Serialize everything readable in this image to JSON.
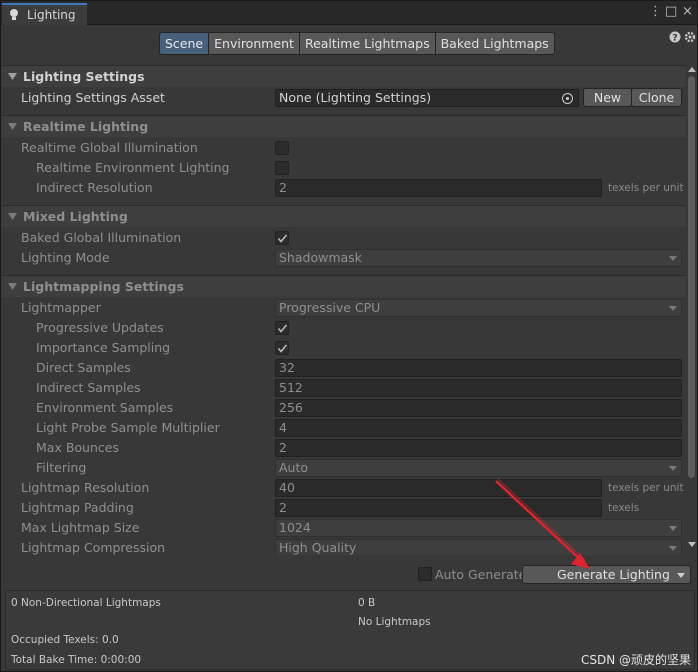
{
  "window": {
    "tab_title": "Lighting",
    "controls": [
      "⋮",
      "□",
      "×"
    ]
  },
  "mode_tabs": [
    {
      "label": "Scene",
      "active": true
    },
    {
      "label": "Environment",
      "active": false
    },
    {
      "label": "Realtime Lightmaps",
      "active": false
    },
    {
      "label": "Baked Lightmaps",
      "active": false
    }
  ],
  "lighting_settings": {
    "header": "Lighting Settings",
    "asset_label": "Lighting Settings Asset",
    "asset_value": "None (Lighting Settings)",
    "new_label": "New",
    "clone_label": "Clone"
  },
  "realtime": {
    "header": "Realtime Lighting",
    "gi_label": "Realtime Global Illumination",
    "gi_checked": false,
    "env_label": "Realtime Environment Lighting",
    "env_checked": false,
    "indirect_label": "Indirect Resolution",
    "indirect_value": "2",
    "indirect_unit": "texels per unit"
  },
  "mixed": {
    "header": "Mixed Lighting",
    "baked_gi_label": "Baked Global Illumination",
    "baked_gi_checked": true,
    "mode_label": "Lighting Mode",
    "mode_value": "Shadowmask"
  },
  "lightmapping": {
    "header": "Lightmapping Settings",
    "lightmapper_label": "Lightmapper",
    "lightmapper_value": "Progressive CPU",
    "progressive_label": "Progressive Updates",
    "progressive_checked": true,
    "importance_label": "Importance Sampling",
    "importance_checked": true,
    "direct_label": "Direct Samples",
    "direct_value": "32",
    "indirect_label": "Indirect Samples",
    "indirect_value": "512",
    "env_label": "Environment Samples",
    "env_value": "256",
    "probe_label": "Light Probe Sample Multiplier",
    "probe_value": "4",
    "bounces_label": "Max Bounces",
    "bounces_value": "2",
    "filtering_label": "Filtering",
    "filtering_value": "Auto",
    "resolution_label": "Lightmap Resolution",
    "resolution_value": "40",
    "resolution_unit": "texels per unit",
    "padding_label": "Lightmap Padding",
    "padding_value": "2",
    "padding_unit": "texels",
    "maxsize_label": "Max Lightmap Size",
    "maxsize_value": "1024",
    "compression_label": "Lightmap Compression",
    "compression_value": "High Quality"
  },
  "generate": {
    "auto_label": "Auto Generate",
    "auto_checked": false,
    "button_label": "Generate Lighting"
  },
  "stats": {
    "lightmaps": "0 Non-Directional Lightmaps",
    "size": "0 B",
    "no_lightmaps": "No Lightmaps",
    "occupied": "Occupied Texels: 0.0",
    "bake_time": "Total Bake Time: 0:00:00"
  },
  "watermark": "CSDN @顽皮的坚果",
  "colors": {
    "accent": "#3a79bb",
    "active_tab": "#46607c",
    "annotation_arrow": "#e0242c"
  }
}
